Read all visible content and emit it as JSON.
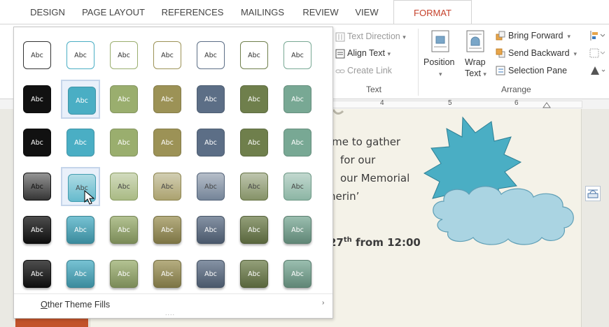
{
  "tabs": [
    {
      "label": "DESIGN"
    },
    {
      "label": "PAGE LAYOUT"
    },
    {
      "label": "REFERENCES"
    },
    {
      "label": "MAILINGS"
    },
    {
      "label": "REVIEW"
    },
    {
      "label": "VIEW"
    },
    {
      "label": "FORMAT",
      "active": true
    }
  ],
  "ribbon": {
    "text_group": {
      "text_direction": "Text Direction",
      "align_text": "Align Text",
      "create_link": "Create Link",
      "label": "Text"
    },
    "arrange_group": {
      "position": "Position",
      "wrap_line1": "Wrap",
      "wrap_line2": "Text",
      "bring_forward": "Bring Forward",
      "send_backward": "Send Backward",
      "selection_pane": "Selection Pane",
      "label": "Arrange"
    }
  },
  "ruler": {
    "numbers": [
      "4",
      "5",
      "6"
    ]
  },
  "document": {
    "lines": [
      "ime to gather",
      "for our",
      "our Memorial",
      "herin’"
    ],
    "date_line_prefix": "27",
    "date_line_sup": "th",
    "date_line_suffix": " from 12:00"
  },
  "gallery": {
    "swatch_label": "Abc",
    "colors": [
      "#111111",
      "#4aaec4",
      "#9aae6e",
      "#9c9256",
      "#5c6e86",
      "#6f7f4c",
      "#78a894"
    ],
    "rows": [
      {
        "style": "outline"
      },
      {
        "style": "solid"
      },
      {
        "style": "solid"
      },
      {
        "style": "gradient"
      },
      {
        "style": "intense"
      },
      {
        "style": "intense"
      }
    ],
    "highlighted_row": 3,
    "highlighted_col": 1,
    "footer": {
      "accel": "O",
      "rest": "ther Theme Fills"
    },
    "grip": "....",
    "sub_arrow": "›"
  },
  "colors": {
    "format_tab": "#c5402a",
    "burst": "#4aaec4",
    "cloud": "#aad4e2",
    "page": "#f4f2e8"
  }
}
